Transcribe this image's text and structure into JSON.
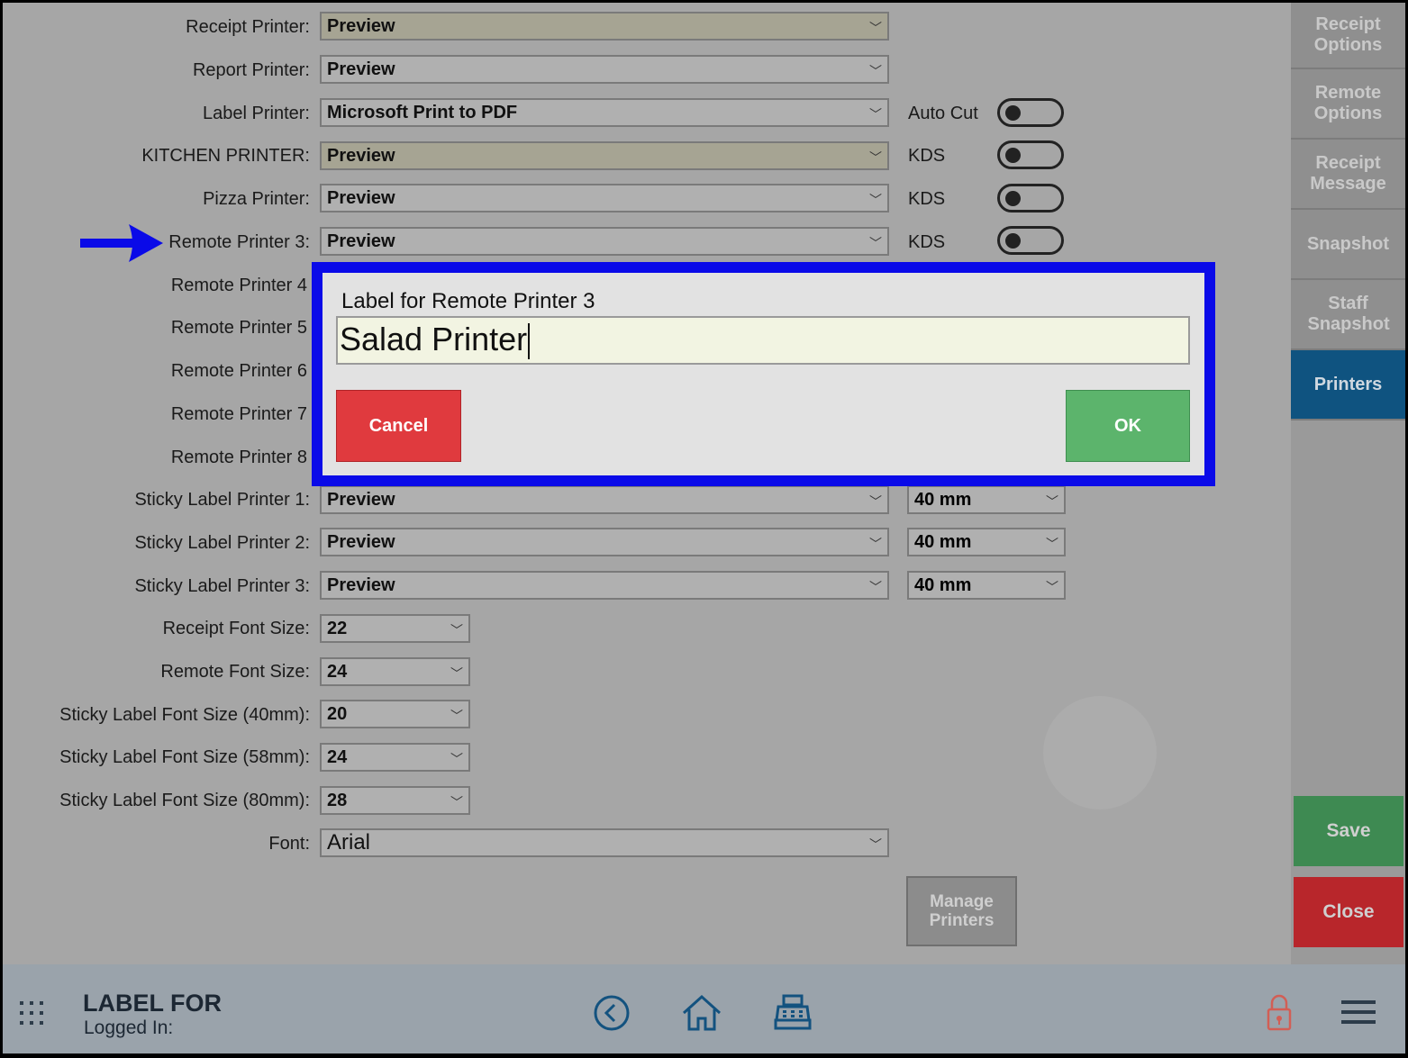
{
  "rows": [
    {
      "label": "Receipt Printer:",
      "value": "Preview"
    },
    {
      "label": "Report Printer:",
      "value": "Preview"
    },
    {
      "label": "Label Printer:",
      "value": "Microsoft Print to PDF",
      "toggle_label": "Auto Cut"
    },
    {
      "label": "KITCHEN PRINTER:",
      "value": "Preview",
      "toggle_label": "KDS"
    },
    {
      "label": "Pizza Printer:",
      "value": "Preview",
      "toggle_label": "KDS"
    },
    {
      "label": "Remote Printer 3:",
      "value": "Preview",
      "toggle_label": "KDS"
    },
    {
      "label": "Remote Printer 4"
    },
    {
      "label": "Remote Printer 5"
    },
    {
      "label": "Remote Printer 6"
    },
    {
      "label": "Remote Printer 7"
    },
    {
      "label": "Remote Printer 8"
    },
    {
      "label": "Sticky Label Printer 1:",
      "value": "Preview",
      "size": "40 mm"
    },
    {
      "label": "Sticky Label Printer 2:",
      "value": "Preview",
      "size": "40 mm"
    },
    {
      "label": "Sticky Label Printer 3:",
      "value": "Preview",
      "size": "40 mm"
    },
    {
      "label": "Receipt Font Size:",
      "value": "22"
    },
    {
      "label": "Remote Font Size:",
      "value": "24"
    },
    {
      "label": "Sticky Label Font Size (40mm):",
      "value": "20"
    },
    {
      "label": "Sticky Label Font Size (58mm):",
      "value": "24"
    },
    {
      "label": "Sticky Label Font Size (80mm):",
      "value": "28"
    },
    {
      "label": "Font:",
      "value": "Arial"
    }
  ],
  "manage_printers": "Manage Printers",
  "sidebar": {
    "tabs": [
      "Receipt Options",
      "Remote Options",
      "Receipt Message",
      "Snapshot",
      "Staff Snapshot",
      "Printers"
    ],
    "active": "Printers",
    "save": "Save",
    "close": "Close"
  },
  "dialog": {
    "title": "Label for Remote Printer 3",
    "value": "Salad Printer",
    "cancel": "Cancel",
    "ok": "OK"
  },
  "bottombar": {
    "title": "LABEL FOR",
    "logged_in": "Logged In:"
  },
  "colors": {
    "arrow": "#0a0ae8",
    "dialog_border": "#0a0ae8",
    "cancel": "#e03a3e",
    "ok": "#5cb46c",
    "save": "#3e8a52",
    "close": "#b8262b",
    "active_tab": "#0f5380"
  }
}
